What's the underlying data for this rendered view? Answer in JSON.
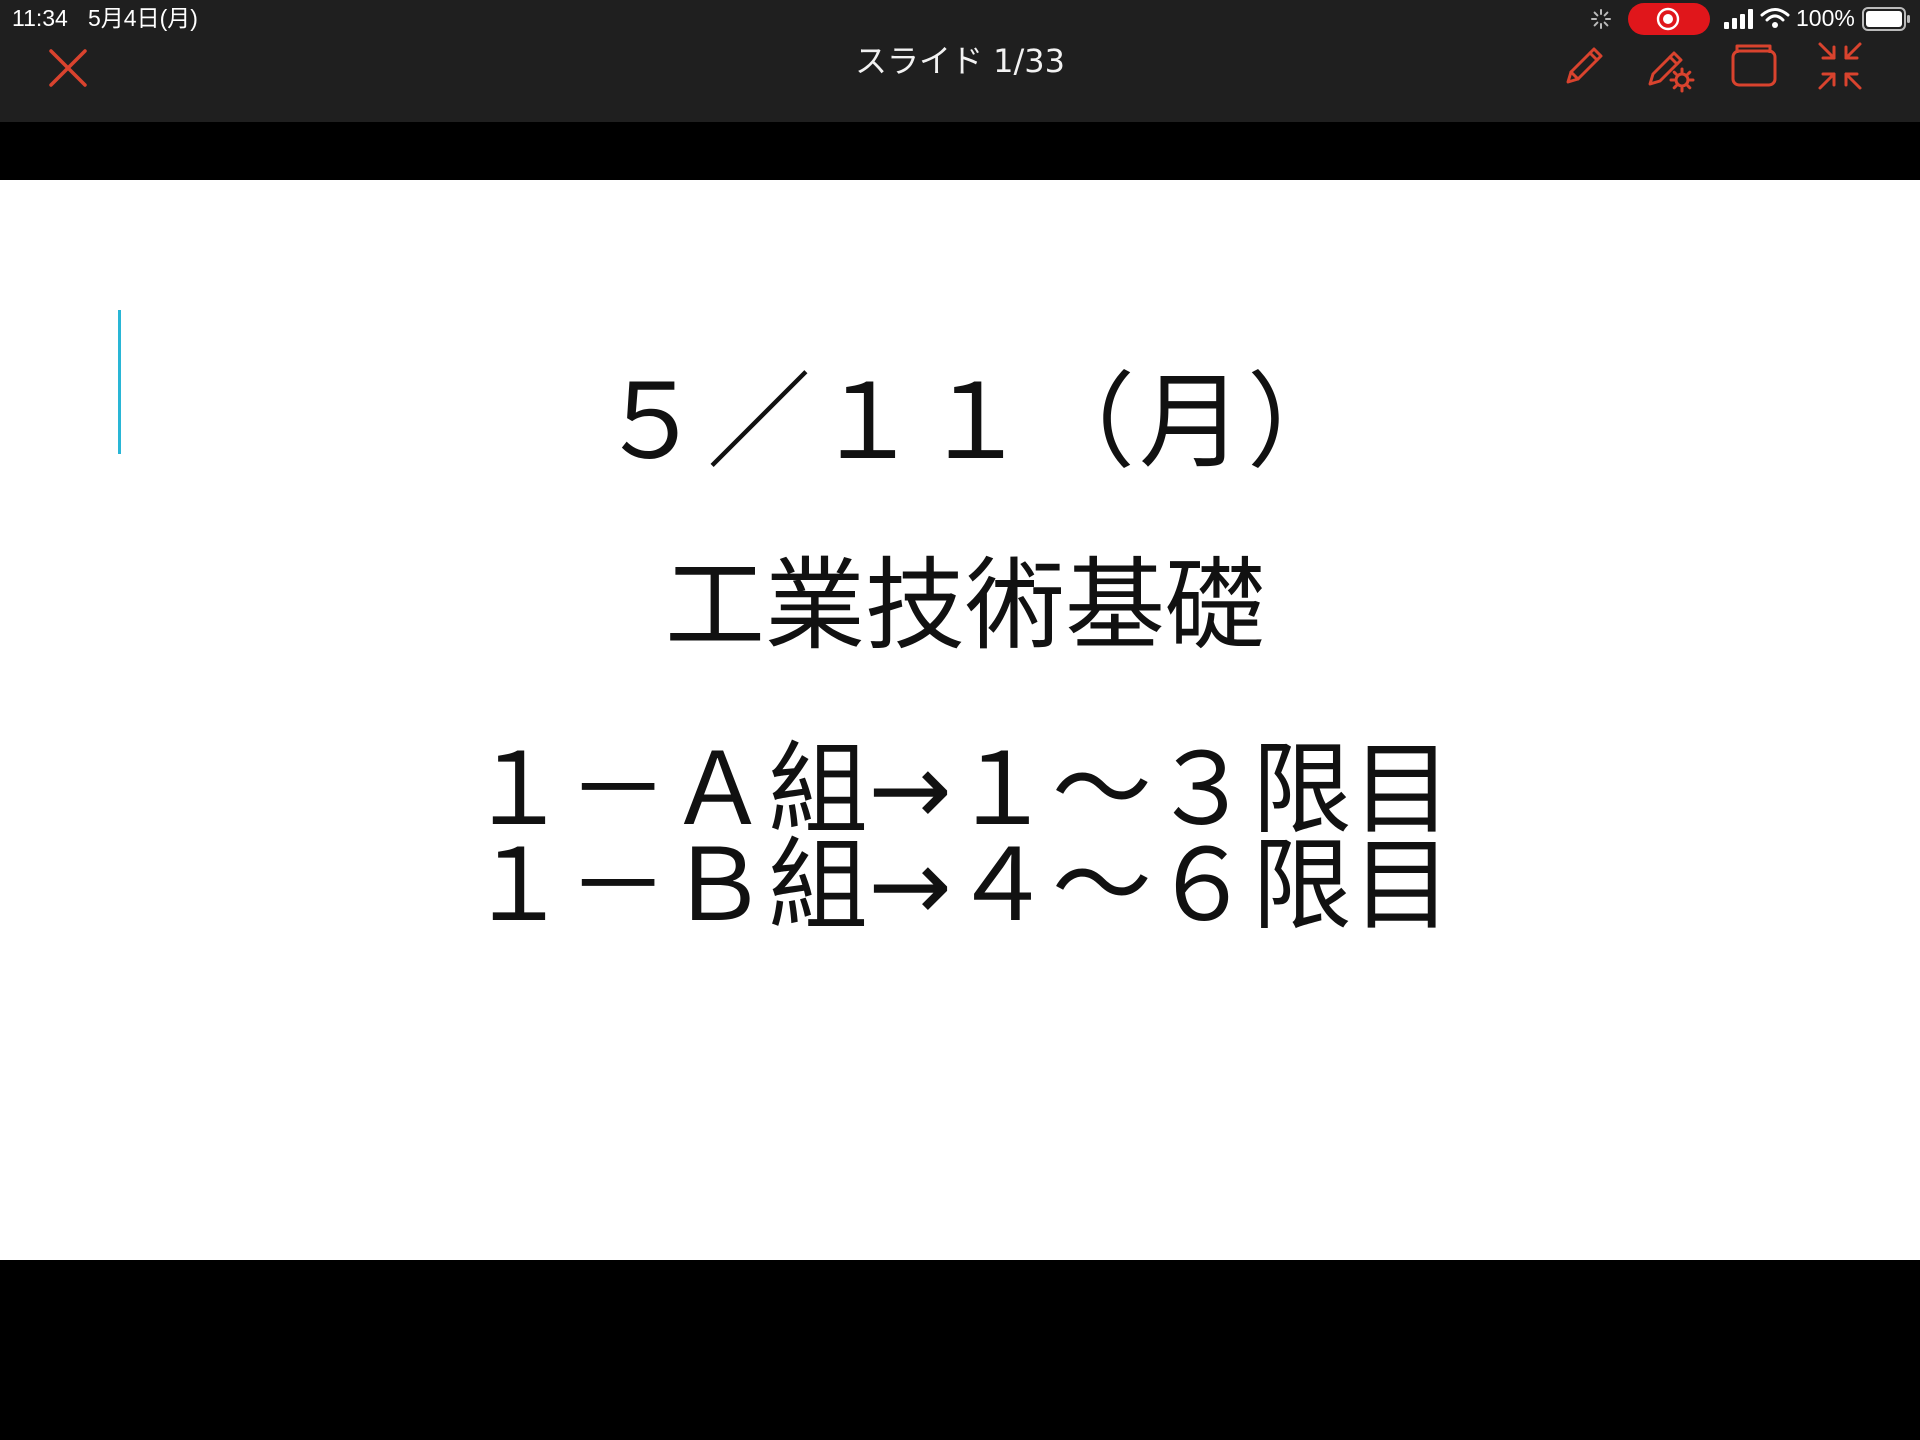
{
  "status_bar": {
    "time": "11:34",
    "date": "5月4日(月)",
    "battery_percent": "100%",
    "record_color": "#e0161b"
  },
  "toolbar": {
    "slide_counter": "スライド 1/33",
    "accent_color": "#d9432e",
    "close_icon": "close-icon",
    "pen_icon": "pencil-icon",
    "pen_settings_icon": "pencil-gear-icon",
    "window_icon": "window-icon",
    "shrink_icon": "shrink-icon"
  },
  "slide": {
    "date_line": "５／１１（月）",
    "subject": "工業技術基礎",
    "group_a": "１－Ａ組→１～３限目",
    "group_b": "１－Ｂ組→４～６限目"
  }
}
